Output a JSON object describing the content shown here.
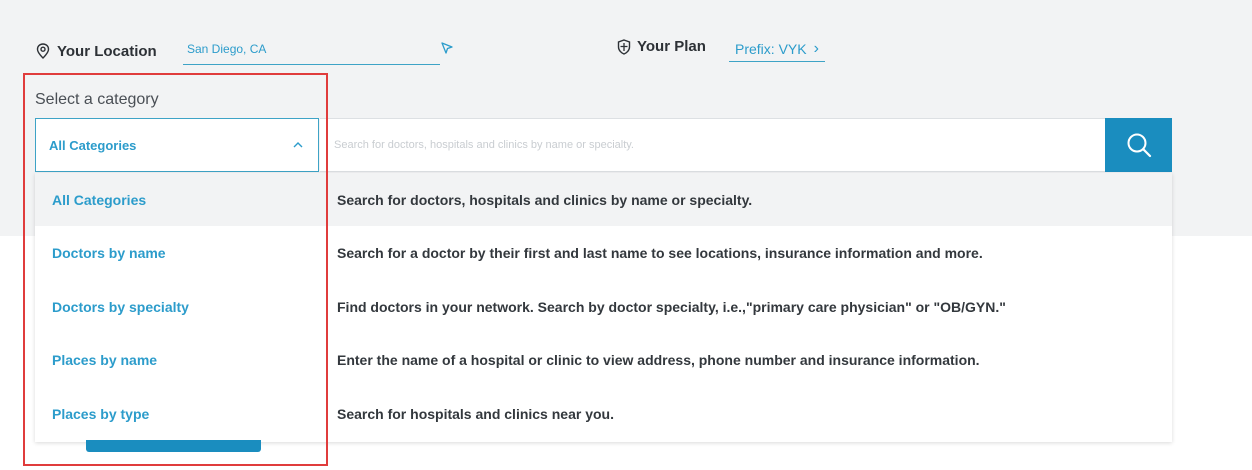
{
  "location": {
    "label": "Your Location",
    "value": "San Diego, CA",
    "icon": "location-pin-icon",
    "action_icon": "navigate-arrow-icon"
  },
  "plan": {
    "label": "Your Plan",
    "link": "Prefix: VYK",
    "icon": "shield-icon",
    "chevron": "›"
  },
  "category": {
    "label": "Select a category",
    "selected": "All Categories"
  },
  "search": {
    "placeholder": "Search for doctors, hospitals and clinics by name or specialty.",
    "icon": "search-icon"
  },
  "options": [
    {
      "name": "All Categories",
      "desc": "Search for doctors, hospitals and clinics by name or specialty."
    },
    {
      "name": "Doctors by name",
      "desc": "Search for a doctor by their first and last name to see locations, insurance information and more."
    },
    {
      "name": "Doctors by specialty",
      "desc": "Find doctors in your network. Search by doctor specialty, i.e.,\"primary care physician\" or \"OB/GYN.\""
    },
    {
      "name": "Places by name",
      "desc": "Enter the name of a hospital or clinic to view address, phone number and insurance information."
    },
    {
      "name": "Places by type",
      "desc": "Search for hospitals and clinics near you."
    }
  ],
  "colors": {
    "accent": "#2c9ccb",
    "button": "#1a8dbf",
    "highlight_box": "#e03c3c",
    "panel_bg": "#f2f3f4"
  }
}
